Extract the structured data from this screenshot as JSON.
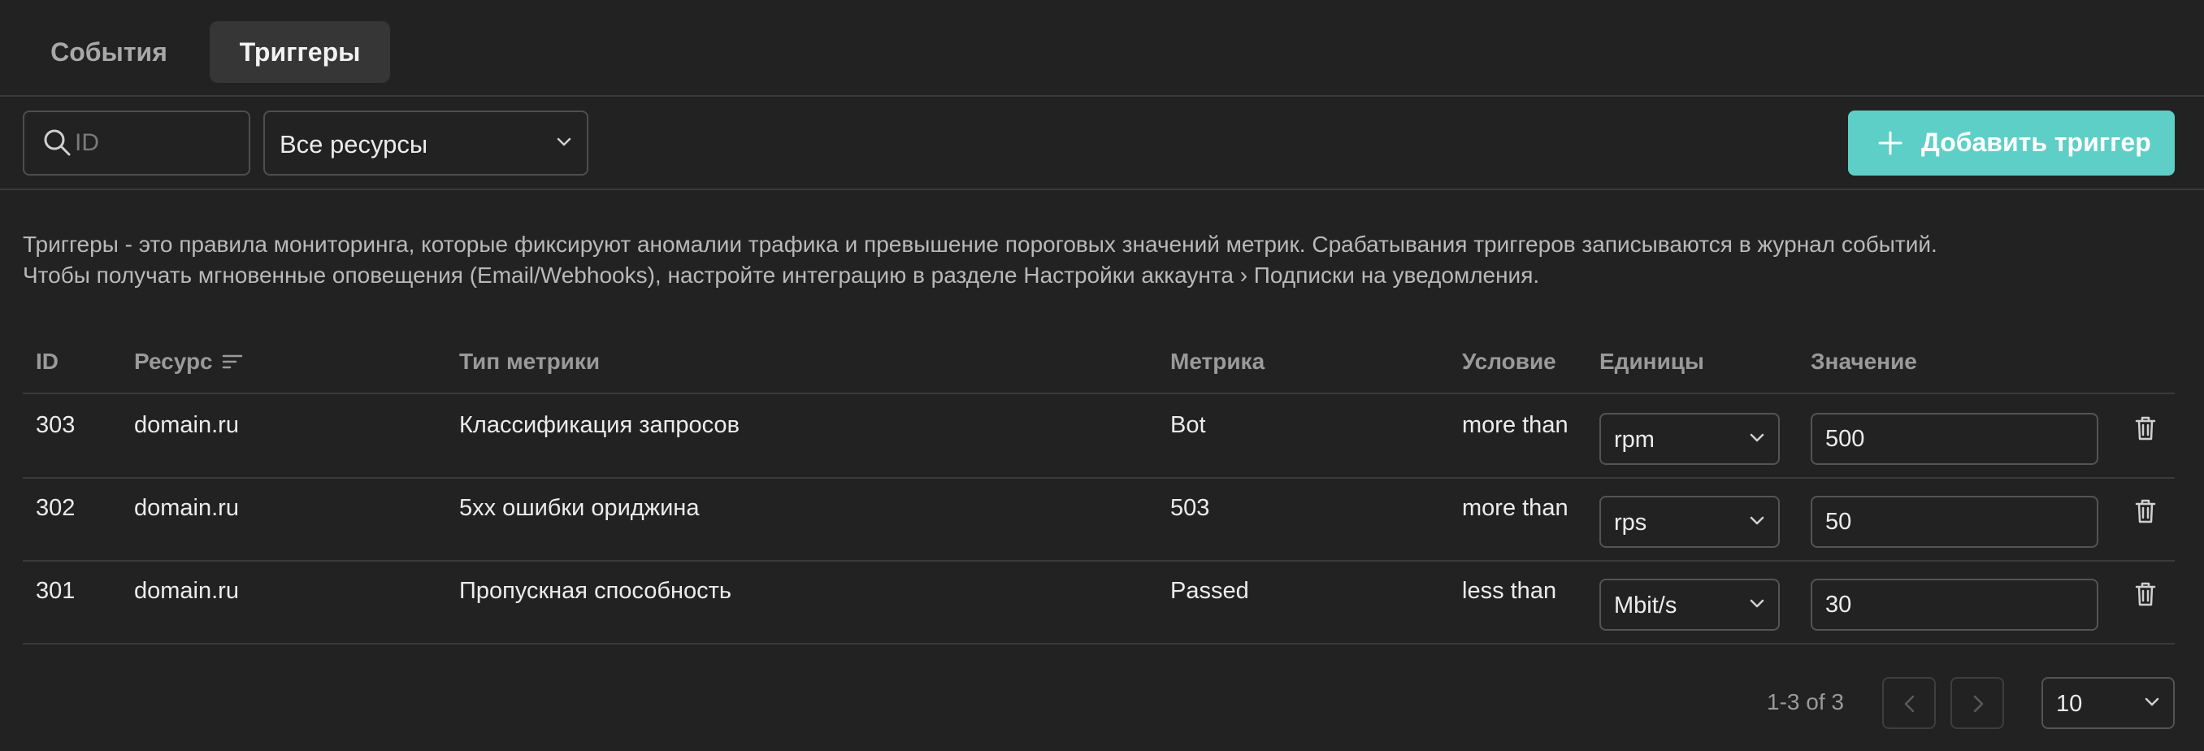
{
  "tabs": [
    {
      "label": "События",
      "active": false
    },
    {
      "label": "Триггеры",
      "active": true
    }
  ],
  "toolbar": {
    "search_placeholder": "ID",
    "resource_filter": "Все ресурсы",
    "add_button_label": "Добавить триггер",
    "accent_color": "#5ecfc6"
  },
  "info": {
    "line1": "Триггеры - это правила мониторинга, которые фиксируют аномалии трафика и превышение пороговых значений метрик. Срабатывания триггеров записываются в журнал событий.",
    "line2": "Чтобы получать мгновенные оповещения (Email/Webhooks), настройте интеграцию в разделе Настройки аккаунта › Подписки на уведомления."
  },
  "table": {
    "columns": [
      "ID",
      "Ресурс",
      "Тип метрики",
      "Метрика",
      "Условие",
      "Единицы",
      "Значение"
    ],
    "rows": [
      {
        "id": "303",
        "resource": "domain.ru",
        "metric_type": "Классификация запросов",
        "metric": "Bot",
        "condition": "more than",
        "unit": "rpm",
        "value": "500"
      },
      {
        "id": "302",
        "resource": "domain.ru",
        "metric_type": "5xx ошибки ориджина",
        "metric": "503",
        "condition": "more than",
        "unit": "rps",
        "value": "50"
      },
      {
        "id": "301",
        "resource": "domain.ru",
        "metric_type": "Пропускная способность",
        "metric": "Passed",
        "condition": "less than",
        "unit": "Mbit/s",
        "value": "30"
      }
    ]
  },
  "pagination": {
    "range_text": "1-3 of 3",
    "page_size": "10"
  },
  "icons": {
    "search": "search-icon",
    "chevron": "chevron-down-icon",
    "plus": "plus-icon",
    "sort": "sort-icon",
    "trash": "trash-icon",
    "prev": "chevron-left-icon",
    "next": "chevron-right-icon"
  }
}
